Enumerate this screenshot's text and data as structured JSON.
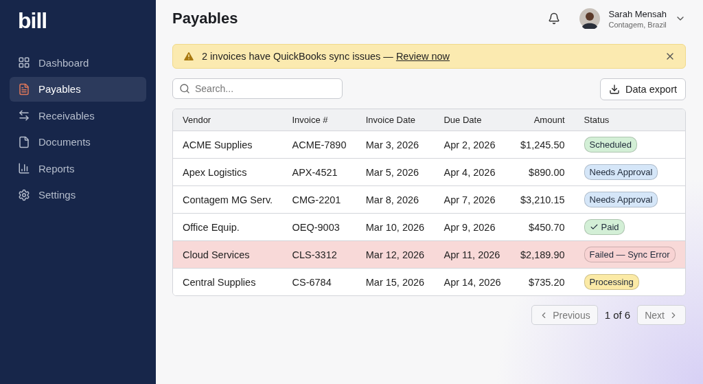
{
  "sidebar": {
    "logo": "bill",
    "items": [
      {
        "label": "Dashboard",
        "selected": false
      },
      {
        "label": "Payables",
        "selected": true
      },
      {
        "label": "Receivables",
        "selected": false
      },
      {
        "label": "Documents",
        "selected": false
      },
      {
        "label": "Reports",
        "selected": false
      },
      {
        "label": "Settings",
        "selected": false
      }
    ]
  },
  "header": {
    "title": "Payables",
    "user": {
      "name": "Sarah Mensah",
      "location": "Contagem, Brazil"
    }
  },
  "alert": {
    "message": "2 invoices have QuickBooks sync issues — ",
    "link": "Review now"
  },
  "search": {
    "placeholder": "Search..."
  },
  "export_button": "Data export",
  "table": {
    "columns": [
      "Vendor",
      "Invoice #",
      "Invoice Date",
      "Due Date",
      "Amount",
      "Status"
    ],
    "rows": [
      {
        "vendor": "ACME Supplies",
        "invoice": "ACME-7890",
        "invoice_date": "Mar 3, 2026",
        "due_date": "Apr 2, 2026",
        "amount": "$1,245.50",
        "status": "Scheduled",
        "color": "#d3efd6",
        "checked": false,
        "flagged": false
      },
      {
        "vendor": "Apex Logistics",
        "invoice": "APX-4521",
        "invoice_date": "Mar 5, 2026",
        "due_date": "Apr 4, 2026",
        "amount": "$890.00",
        "status": "Needs Approval",
        "color": "#d5e6f8",
        "checked": false,
        "flagged": false
      },
      {
        "vendor": "Contagem MG Serv.",
        "invoice": "CMG-2201",
        "invoice_date": "Mar 8, 2026",
        "due_date": "Apr 7, 2026",
        "amount": "$3,210.15",
        "status": "Needs Approval",
        "color": "#d5e6f8",
        "checked": false,
        "flagged": false
      },
      {
        "vendor": "Office Equip.",
        "invoice": "OEQ-9003",
        "invoice_date": "Mar 10, 2026",
        "due_date": "Apr 9, 2026",
        "amount": "$450.70",
        "status": "Paid",
        "color": "#d3efd6",
        "checked": true,
        "flagged": false
      },
      {
        "vendor": "Cloud Services",
        "invoice": "CLS-3312",
        "invoice_date": "Mar 12, 2026",
        "due_date": "Apr 11, 2026",
        "amount": "$2,189.90",
        "status": "Failed — Sync Error",
        "color": "#f8d3d3",
        "checked": false,
        "flagged": true
      },
      {
        "vendor": "Central Supplies",
        "invoice": "CS-6784",
        "invoice_date": "Mar 15, 2026",
        "due_date": "Apr 14, 2026",
        "amount": "$735.20",
        "status": "Processing",
        "color": "#fbeaa6",
        "checked": false,
        "flagged": false
      }
    ]
  },
  "pagination": {
    "previous": "Previous",
    "page": "1 of 6",
    "next": "Next"
  }
}
